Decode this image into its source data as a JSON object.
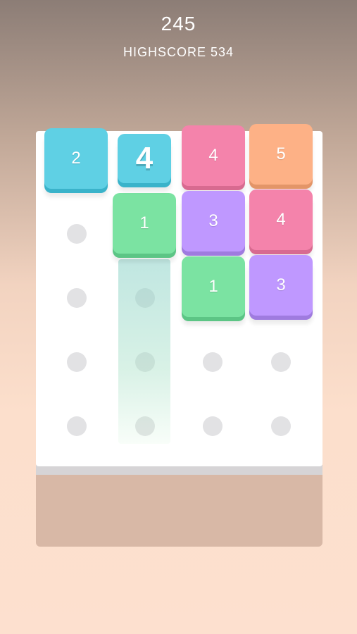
{
  "header": {
    "score": "245",
    "highscore": "HIGHSCORE 534"
  },
  "colors": {
    "blue": "#5fd0e4",
    "pink": "#f483ab",
    "orange": "#fdb186",
    "green": "#7be3a2",
    "purple": "#bf98ff",
    "board": "#ffffff",
    "dot": "#e2e2e4"
  },
  "board": {
    "columns": 4,
    "next_tile": {
      "value": "4",
      "color": "blue",
      "column": 2
    },
    "tiles": [
      {
        "value": "2",
        "color": "blue",
        "column": 1,
        "row": 1
      },
      {
        "value": "4",
        "color": "pink",
        "column": 3,
        "row": 1
      },
      {
        "value": "5",
        "color": "orange",
        "column": 4,
        "row": 1
      },
      {
        "value": "1",
        "color": "green",
        "column": 2,
        "row": 2
      },
      {
        "value": "3",
        "color": "purple",
        "column": 3,
        "row": 2
      },
      {
        "value": "4",
        "color": "pink",
        "column": 4,
        "row": 2
      },
      {
        "value": "1",
        "color": "green",
        "column": 3,
        "row": 3
      },
      {
        "value": "3",
        "color": "purple",
        "column": 4,
        "row": 3
      }
    ]
  }
}
